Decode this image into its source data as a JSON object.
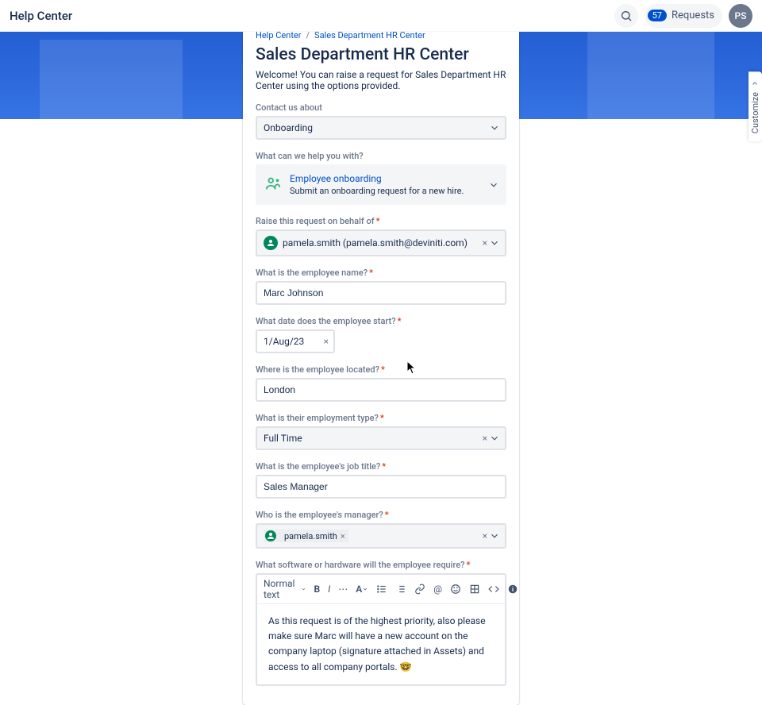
{
  "topbar": {
    "title": "Help Center",
    "requests_count": "57",
    "requests_label": "Requests",
    "avatar_initials": "PS"
  },
  "customize_tab": "Customize",
  "breadcrumb": {
    "home": "Help Center",
    "portal": "Sales Department HR Center"
  },
  "page": {
    "title": "Sales Department HR Center",
    "description": "Welcome! You can raise a request for Sales Department HR Center using the options provided."
  },
  "fields": {
    "contact_label": "Contact us about",
    "contact_value": "Onboarding",
    "help_label": "What can we help you with?",
    "request_type_title": "Employee onboarding",
    "request_type_desc": "Submit an onboarding request for a new hire.",
    "behalf_label": "Raise this request on behalf of",
    "behalf_value": "pamela.smith (pamela.smith@deviniti.com)",
    "name_label": "What is the employee name?",
    "name_value": "Marc Johnson",
    "date_label": "What date does the employee start?",
    "date_value": "1/Aug/23",
    "located_label": "Where is the employee located?",
    "located_value": "London",
    "emp_type_label": "What is their employment type?",
    "emp_type_value": "Full Time",
    "job_title_label": "What is the employee's job title?",
    "job_title_value": "Sales Manager",
    "manager_label": "Who is the employee's manager?",
    "manager_chip": "pamela.smith",
    "software_label": "What software or hardware will the employee require?"
  },
  "rte": {
    "style_label": "Normal text",
    "body": "As this request is of the highest priority, also please make sure Marc will have a new account on the company laptop (signature attached in Assets) and access to all company portals. 🤓"
  },
  "required": "*"
}
